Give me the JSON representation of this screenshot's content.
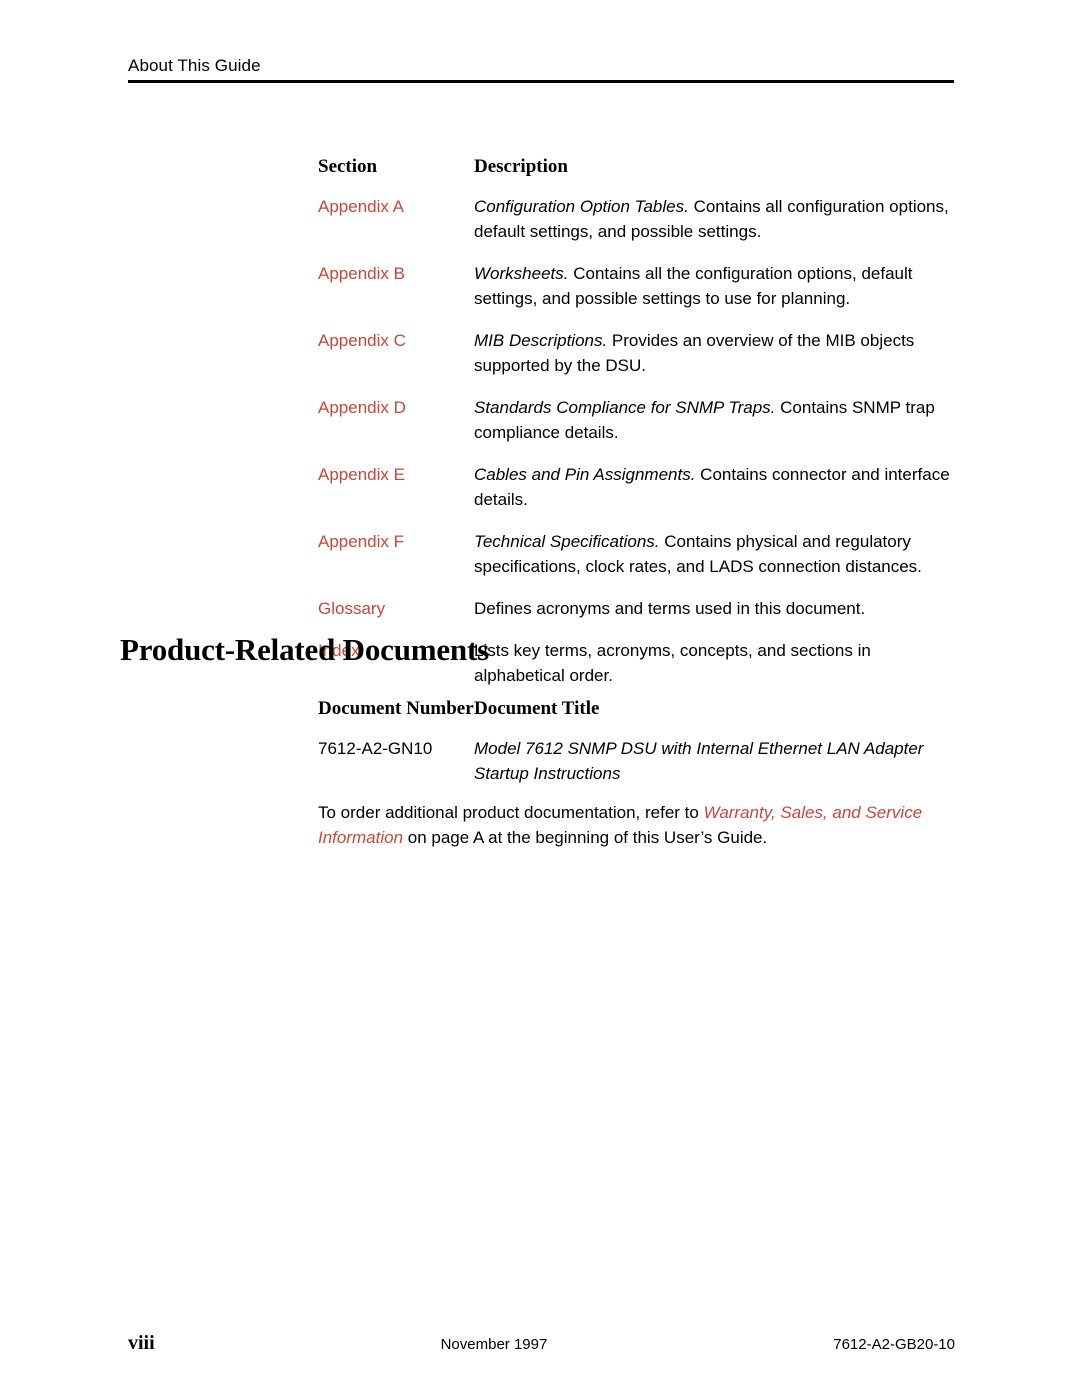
{
  "colors": {
    "link_red": "#C7483A",
    "text_black": "#000000",
    "page_background": "#FFFFFF"
  },
  "running_header": {
    "title": "About This Guide"
  },
  "sections_table": {
    "headers": {
      "col_section": "Section",
      "col_description": "Description"
    },
    "rows": [
      {
        "section": "Appendix A",
        "desc_title": "Configuration Option Tables.",
        "desc_rest": " Contains all configuration options, default settings, and possible settings."
      },
      {
        "section": "Appendix B",
        "desc_title": "Worksheets.",
        "desc_rest": " Contains all the configuration options, default settings, and possible settings to use for planning."
      },
      {
        "section": "Appendix C",
        "desc_title": "MIB Descriptions.",
        "desc_rest": " Provides an overview of the MIB objects supported by the DSU."
      },
      {
        "section": "Appendix D",
        "desc_title": "Standards Compliance for SNMP Traps.",
        "desc_rest": " Contains SNMP trap compliance details."
      },
      {
        "section": "Appendix E",
        "desc_title": "Cables and Pin Assignments.",
        "desc_rest": " Contains connector and interface details."
      },
      {
        "section": "Appendix F",
        "desc_title": "Technical Specifications.",
        "desc_rest": " Contains physical and regulatory specifications, clock rates, and LADS connection distances."
      },
      {
        "section": "Glossary",
        "desc_title": "",
        "desc_rest": "Defines acronyms and terms used in this document."
      },
      {
        "section": "Index",
        "desc_title": "",
        "desc_rest": "Lists key terms, acronyms, concepts, and sections in alphabetical order."
      }
    ]
  },
  "product_documents": {
    "heading": "Product-Related Documents",
    "headers": {
      "col_number": "Document Number",
      "col_title": "Document Title"
    },
    "rows": [
      {
        "number": "7612-A2-GN10",
        "title": "Model 7612 SNMP DSU with Internal Ethernet LAN Adapter Startup Instructions"
      }
    ]
  },
  "order_paragraph": {
    "lead": "To order additional product documentation, refer to ",
    "xref": "Warranty, Sales, and Service Information",
    "tail": " on page A at the beginning of this User’s Guide."
  },
  "footer": {
    "page_number": "viii",
    "date": "November 1997",
    "document_number": "7612-A2-GB20-10"
  }
}
